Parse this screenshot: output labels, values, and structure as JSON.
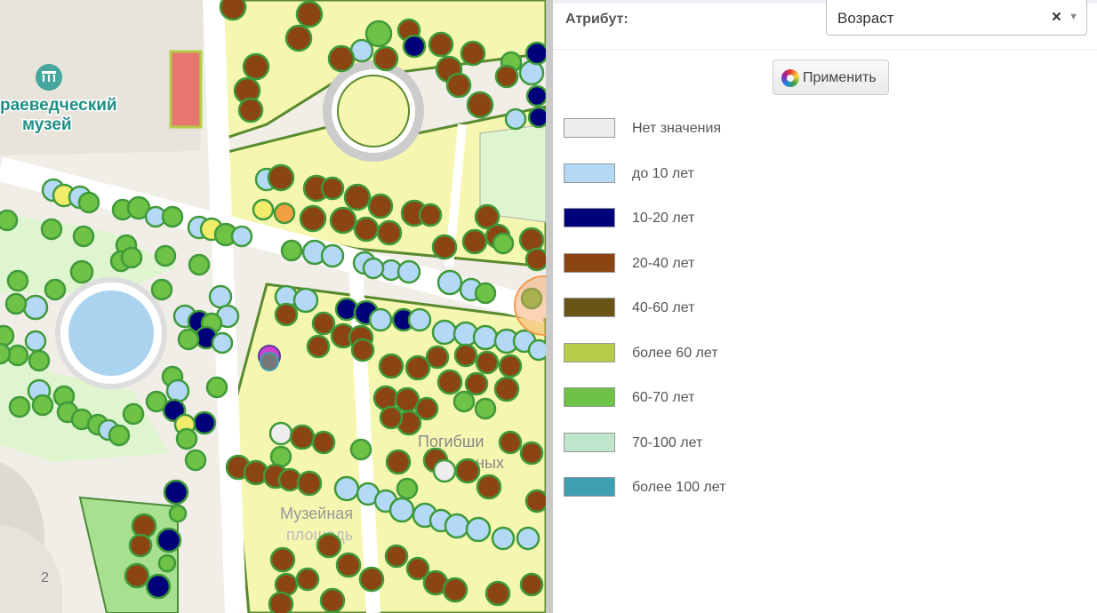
{
  "map": {
    "labels": {
      "museum": "раеведческий\nмузей",
      "street1": "Погибши",
      "street2": "ных",
      "square1": "Музейная",
      "square2": "площадь",
      "number": "2"
    }
  },
  "panel": {
    "attribute_label": "Атрибут:",
    "select": {
      "value": "Возраст",
      "clear_icon": "×",
      "arrow_icon": "▼"
    },
    "apply_button": "Применить",
    "legend": [
      {
        "label": "Нет значения",
        "color": "#eeeeee"
      },
      {
        "label": "до 10 лет",
        "color": "#b3d9f7"
      },
      {
        "label": "10-20 лет",
        "color": "#00007a"
      },
      {
        "label": "20-40 лет",
        "color": "#8b4513"
      },
      {
        "label": "40-60 лет",
        "color": "#6b5417"
      },
      {
        "label": "более 60 лет",
        "color": "#b5cd49"
      },
      {
        "label": "60-70 лет",
        "color": "#6ec245"
      },
      {
        "label": "70-100 лет",
        "color": "#bfe6cd"
      },
      {
        "label": "более 100 лет",
        "color": "#3f9fb2"
      }
    ]
  }
}
